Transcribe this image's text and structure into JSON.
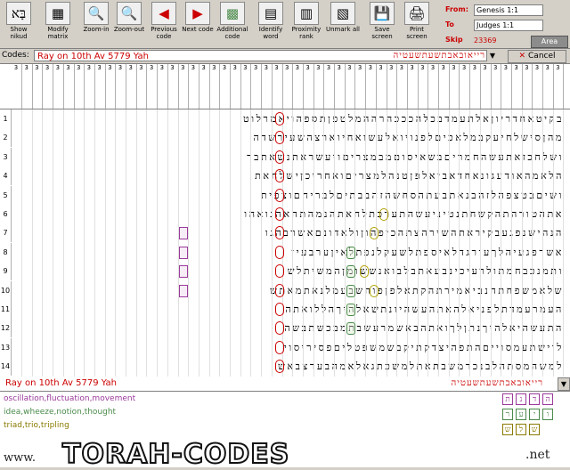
{
  "toolbar": {
    "buttons": [
      {
        "label": "Show nikud",
        "glyph": "בָּא"
      },
      {
        "label": "Modify matrix",
        "glyph": "▦"
      },
      {
        "label": "Zoom-in",
        "glyph": "🔍"
      },
      {
        "label": "Zoom-out",
        "glyph": "🔍"
      },
      {
        "label": "Previous code",
        "glyph": "◀"
      },
      {
        "label": "Next code",
        "glyph": "▶"
      },
      {
        "label": "Additional code",
        "glyph": "▩"
      },
      {
        "label": "Identify word",
        "glyph": "▤"
      },
      {
        "label": "Proximity rank",
        "glyph": "▥"
      },
      {
        "label": "Unmark all",
        "glyph": "▧"
      },
      {
        "label": "Save screen",
        "glyph": "💾"
      },
      {
        "label": "Print screen",
        "glyph": "🖨"
      }
    ]
  },
  "nav": {
    "from_label": "From:",
    "from_value": "Genesis 1:1",
    "to_label": "To",
    "to_value": "Judges 1:1",
    "skip_label": "Skip",
    "skip_value": "23369",
    "area_label": "Area"
  },
  "codes": {
    "label": "Codes:",
    "value": "Ray on 10th Av 5779 Yah",
    "hebrew": "רייאובאבתשעתשעטיה",
    "cancel_label": "Cancel"
  },
  "grid": {
    "column_header": [
      "3",
      "3",
      "3",
      "3",
      "3",
      "3",
      "3",
      "3",
      "3",
      "3",
      "3",
      "3",
      "3",
      "3",
      "3",
      "3",
      "3",
      "3",
      "3",
      "3",
      "3",
      "3",
      "3",
      "3",
      "3",
      "3",
      "3",
      "3",
      "3",
      "3",
      "3",
      "3",
      "3",
      "3",
      "3",
      "3",
      "3",
      "3",
      "3",
      "3",
      "3",
      "3",
      "3",
      "3",
      "3",
      "3",
      "3",
      "3",
      "3",
      "3",
      "3",
      "3",
      "3"
    ],
    "rows": [
      {
        "n": "1",
        "text": "בקיטאחדריוןאלתעמדבכלהכככהרההמלטפןתספהויאמרלוט"
      },
      {
        "n": "2",
        "text": "מהןסישלחיעקבמלאכיםלפנויואלעשואחיוארצהשעירשדה"
      },
      {
        "n": "3",
        "text": "ושלחכזאתעשהחמריםבשאיסוםמבמצריםויעשראתנשאתבר"
      },
      {
        "n": "4",
        "text": "הלאמהאודעגונאחדאביאלפןטנהלמצריםואחריכןישלחאת"
      },
      {
        "n": "5",
        "text": "ושיםבטצפהלזהבנאתבעתהסחשהזהבבתיםלבריחםוצפית"
      },
      {
        "n": "6",
        "text": "אתהטורהתהקשחתנטיניעשהתערכתלחאתהנמהתהאהנואהו"
      },
      {
        "n": "7",
        "text": "הנהישנפגעבקיראתהשירהצתהכיפהוןולאדונםאשרבהגו"
      },
      {
        "n": "8",
        "text": "אשרפגעיהלךעורגדלאיספתלשעקלנפתלאיןערבעיז"
      },
      {
        "n": "9",
        "text": "ותמנכבחמתולרעיכינבעאתבלבואנששומןהמשיתלש"
      },
      {
        "n": "10",
        "text": "שלאמשפחתהנביאמירתהקתאלפןפוהשבעמלנאתמאתש"
      },
      {
        "n": "11",
        "text": "העמרעמדתלפניאלהאתהעשהיונתשאלהיךהללואתה"
      },
      {
        "n": "12",
        "text": "התעשהיאלהיךנתןלךואתהבאשמרעשבתמבכשתבשה"
      },
      {
        "n": "13",
        "text": "לוישתעמסוייםהתפהיצדקתיקבשמשפטליםפסיריסוי"
      },
      {
        "n": "14",
        "text": "למשהמסתהלבנכרמשבתאתלמשכתגאלאמהבערצבאש"
      }
    ]
  },
  "bottom": {
    "code_text": "Ray on 10th Av 5779 Yah",
    "hebrew": "רייאובאבתשעתשעטיה"
  },
  "results": [
    {
      "text": "oscillation,fluctuation,movement",
      "color": "#9b3a9b"
    },
    {
      "text": "idea,wheeze,notion,thought",
      "color": "#4a8a4a"
    },
    {
      "text": "triad,trio,tripling",
      "color": "#8a7a00"
    }
  ],
  "legend": {
    "row1": [
      "ת",
      "נ",
      "ד",
      "ה"
    ],
    "row2": [
      "ר",
      "ע",
      "י",
      "ו"
    ],
    "row3": [
      "ש",
      "ל",
      "ש"
    ]
  },
  "banner": {
    "www": "www.",
    "main": "TORAH-CODES",
    "net": ".net"
  },
  "colors": {
    "accent": "#cc0000",
    "purple": "#9b3a9b",
    "green": "#4a8a4a",
    "olive": "#8a7a00"
  }
}
